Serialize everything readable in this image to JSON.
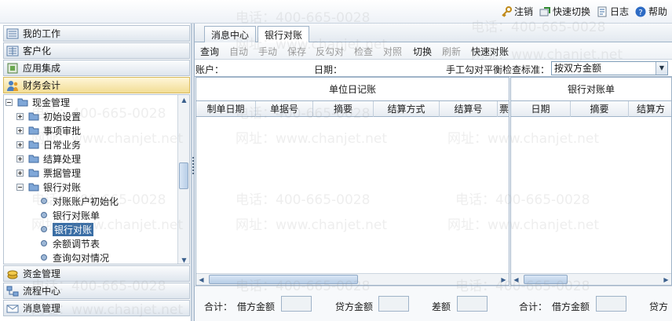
{
  "topbar": {
    "logout": "注销",
    "quick_switch": "快速切换",
    "log": "日志",
    "help": "帮助"
  },
  "nav": {
    "headers_top": [
      {
        "label": "我的工作"
      },
      {
        "label": "客户化"
      },
      {
        "label": "应用集成"
      },
      {
        "label": "财务会计"
      }
    ],
    "headers_bottom": [
      {
        "label": "资金管理"
      },
      {
        "label": "流程中心"
      },
      {
        "label": "消息管理"
      }
    ],
    "tree": {
      "root": "现金管理",
      "folders": [
        "初始设置",
        "事项审批",
        "日常业务",
        "结算处理",
        "票据管理",
        "银行对账"
      ],
      "leaves": [
        "对账账户初始化",
        "银行对账单",
        "银行对账",
        "余额调节表",
        "查询勾对情况"
      ]
    }
  },
  "tabs": [
    {
      "label": "消息中心"
    },
    {
      "label": "银行对账"
    }
  ],
  "toolbar": {
    "buttons": [
      "查询",
      "自动",
      "手动",
      "保存",
      "反勾对",
      "检查",
      "对照",
      "切换",
      "刷新",
      "快速对账"
    ]
  },
  "filter": {
    "account_label": "账户：",
    "date_label": "日期：",
    "standard_label": "手工勾对平衡检查标准：",
    "standard_value": "按双方金额"
  },
  "left_pane": {
    "title": "单位日记账",
    "columns": [
      "制单日期",
      "单据号",
      "摘要",
      "结算方式",
      "结算号",
      "票"
    ]
  },
  "right_pane": {
    "title": "银行对账单",
    "columns": [
      "日期",
      "摘要",
      "结算方"
    ]
  },
  "footer": {
    "total": "合计：",
    "debit_left": "借方金额",
    "credit_left": "贷方金额",
    "diff": "差额",
    "total2": "合计：",
    "debit_right": "借方金额",
    "credit_right": "贷方"
  },
  "watermark": {
    "phone": "电话：400-665-0028",
    "site": "网址：www.chanjet.net"
  },
  "colors": {
    "accent": "#3a6ea5",
    "border": "#9fb3c8",
    "active_nav": "#f2dd95"
  }
}
